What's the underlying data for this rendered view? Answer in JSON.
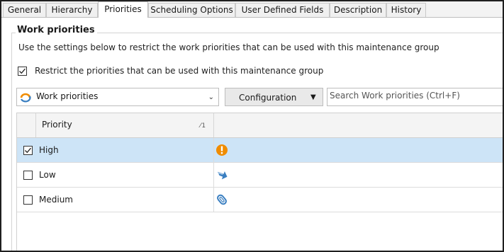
{
  "tabs": [
    {
      "label": "General",
      "active": false
    },
    {
      "label": "Hierarchy",
      "active": false
    },
    {
      "label": "Priorities",
      "active": true
    },
    {
      "label": "Scheduling Options",
      "active": false
    },
    {
      "label": "User Defined Fields",
      "active": false
    },
    {
      "label": "Description",
      "active": false
    },
    {
      "label": "History",
      "active": false
    }
  ],
  "group": {
    "title": "Work priorities",
    "description": "Use the settings below to restrict the work priorities that can be used with this maintenance group",
    "restrict_checkbox": {
      "label": "Restrict the priorities that can be used with this maintenance group",
      "checked": true
    }
  },
  "toolbar": {
    "combo_value": "Work priorities",
    "combo_icon": "work-priorities-icon",
    "configuration_label": "Configuration",
    "search_placeholder": "Search Work priorities  (Ctrl+F)"
  },
  "grid": {
    "column_header": "Priority",
    "sort_indicator": "1",
    "rows": [
      {
        "name": "High",
        "checked": true,
        "selected": true,
        "icon": "exclamation-icon",
        "icon_color": "#f08c00"
      },
      {
        "name": "Low",
        "checked": false,
        "selected": false,
        "icon": "down-arrow-icon",
        "icon_color": "#3a7fc1"
      },
      {
        "name": "Medium",
        "checked": false,
        "selected": false,
        "icon": "paperclip-icon",
        "icon_color": "#3a7fc1"
      }
    ]
  },
  "colors": {
    "selected_row": "#cde4f7",
    "priority_high": "#f08c00",
    "priority_low": "#3a7fc1"
  }
}
